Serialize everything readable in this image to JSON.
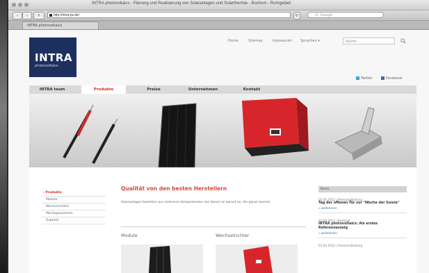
{
  "browser": {
    "window_title": "INTRA photovoltaics - Planung und Realisierung von Solaranlagen und Solarthermie - Bochum - Ruhrgebiet",
    "url": "http://intra-pv.de/",
    "web_search_placeholder": "Q- Google",
    "tab_label": "INTRA photovoltaics"
  },
  "site": {
    "logo_text": "INTRA",
    "logo_sub": "photovoltaics",
    "top_nav": [
      "Home",
      "Sitemap",
      "Impressum",
      "Sprachen"
    ],
    "search_placeholder": "Suche",
    "social": [
      "Twitter",
      "Facebook"
    ],
    "main_nav": [
      "INTRA team",
      "Produkte",
      "Preise",
      "Unternehmen",
      "Kontakt"
    ],
    "active_nav_index": 1,
    "accent_color": "#e2231a",
    "brand_color": "#1d2f5e"
  },
  "content": {
    "subnav": [
      "› Produkte",
      "Module",
      "Wechselrichter",
      "Montagesysteme",
      "Zubehör"
    ],
    "headline": "Qualität von den besten Herstellern",
    "intro": "Solaranlagen bestehen aus mehreren Komponenten, bei denen es darauf an, die ganze kommt.",
    "col1_title": "Module",
    "col2_title": "Wechselrichter"
  },
  "news": {
    "heading": "News",
    "items": [
      {
        "date": "05.05.2012 | Pressemitteilung",
        "title": "Tag der offenen Tür zur \"Woche der Sonne\"",
        "more": "» weiterlesen"
      },
      {
        "date": "22.04.2012 | Exzerrat",
        "title": "INTRA photovoltaics: Als erstes Referenzanzeig",
        "more": "» weiterlesen"
      },
      {
        "date": "03.04.2012 | Pressemitteilung",
        "title": "",
        "more": ""
      }
    ]
  }
}
